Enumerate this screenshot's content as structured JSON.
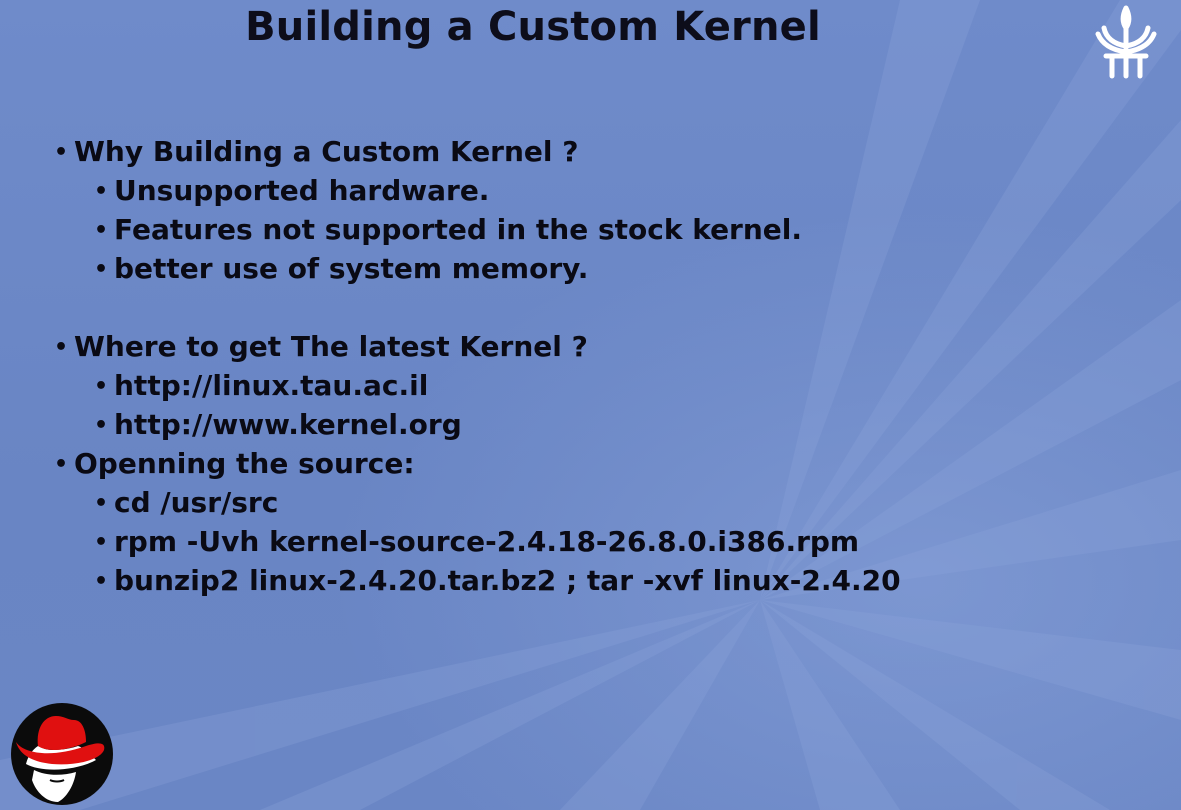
{
  "slide": {
    "title": "Building a Custom Kernel",
    "bullet_glyph": "•",
    "sections": [
      {
        "heading": "Why Building a Custom Kernel ?",
        "items": [
          "Unsupported hardware.",
          "Features not supported in the stock kernel.",
          "better use of system memory."
        ]
      },
      {
        "heading": "Where to get The latest Kernel ?",
        "items": [
          "http://linux.tau.ac.il",
          "http://www.kernel.org"
        ]
      },
      {
        "heading": "Openning the source:",
        "items": [
          "cd /usr/src",
          "rpm -Uvh kernel-source-2.4.18-26.8.0.i386.rpm",
          "bunzip2 linux-2.4.20.tar.bz2 ; tar -xvf linux-2.4.20"
        ]
      }
    ]
  },
  "icons": {
    "emblem": "university-emblem-icon",
    "logo": "red-hat-logo-icon"
  },
  "colors": {
    "background": "#6a86c4",
    "text": "#0a0a14",
    "hat_red": "#e01010"
  }
}
